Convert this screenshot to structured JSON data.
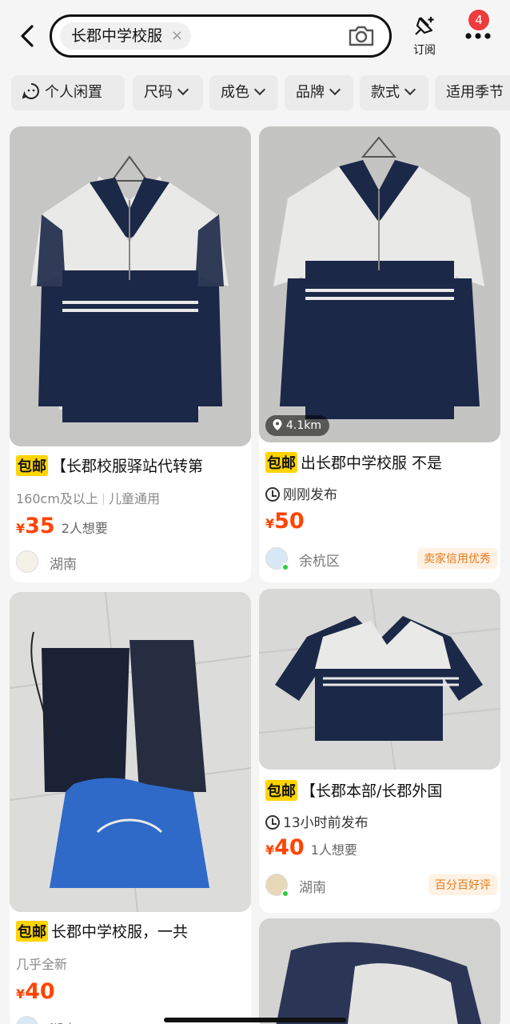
{
  "header": {
    "search_query": "长郡中学校服",
    "clear_label": "×",
    "subscribe_label": "订阅",
    "badge_count": "4"
  },
  "filters": [
    {
      "label": "个人闲置",
      "icon": "idle-face-icon"
    },
    {
      "label": "尺码"
    },
    {
      "label": "成色"
    },
    {
      "label": "品牌"
    },
    {
      "label": "款式"
    },
    {
      "label": "适用季节"
    }
  ],
  "listings": [
    {
      "free_shipping": "包邮",
      "title": "【长郡校服驿站代转第",
      "meta": [
        "160cm及以上",
        "儿童通用"
      ],
      "price_symbol": "¥",
      "price": "35",
      "wants": "2人想要",
      "location": "湖南"
    },
    {
      "free_shipping": "包邮",
      "title": "出长郡中学校服 不是",
      "tag": "刚刚发布",
      "price_symbol": "¥",
      "price": "50",
      "location": "余杭区",
      "badge": "卖家信用优秀",
      "distance": "4.1km"
    },
    {
      "free_shipping": "包邮",
      "title": "长郡中学校服，一共",
      "meta": [
        "几乎全新"
      ],
      "price_symbol": "¥",
      "price": "40",
      "location": "湖南"
    },
    {
      "free_shipping": "包邮",
      "title": "【长郡本部/长郡外国",
      "tag": "13小时前发布",
      "price_symbol": "¥",
      "price": "40",
      "wants": "1人想要",
      "location": "湖南",
      "badge": "百分百好评"
    }
  ],
  "colors": {
    "price": "#ff4400",
    "free_shipping_bg": "#ffd400",
    "badge_red": "#ef3b3b",
    "credit_badge": "#e47b1a",
    "jacket_navy": "#1c2848",
    "jacket_white": "#e9e9e7"
  }
}
